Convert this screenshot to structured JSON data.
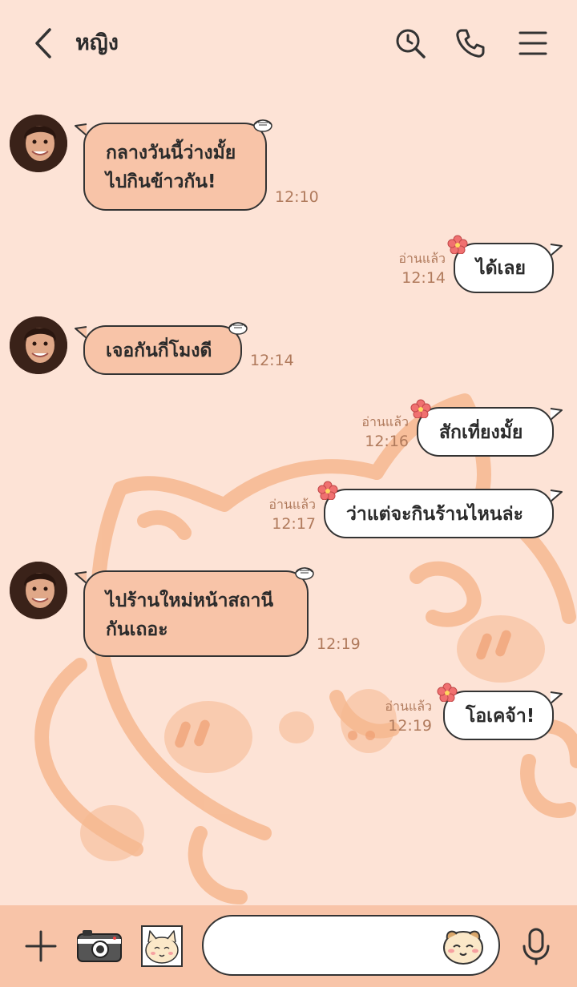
{
  "header": {
    "title": "หญิง",
    "icons": [
      "back-icon",
      "search-history-icon",
      "phone-icon",
      "menu-icon"
    ]
  },
  "messages": [
    {
      "side": "in",
      "lines": [
        "กลางวันนี้ว่างมั้ย",
        "ไปกินข้าวกัน!"
      ],
      "time": "12:10"
    },
    {
      "side": "out",
      "text": "ได้เลย",
      "status": "อ่านแล้ว",
      "time": "12:14"
    },
    {
      "side": "in",
      "text": "เจอกันกี่โมงดี",
      "time": "12:14"
    },
    {
      "side": "out",
      "text": "สักเที่ยงมั้ย",
      "status": "อ่านแล้ว",
      "time": "12:16"
    },
    {
      "side": "out",
      "text": "ว่าแต่จะกินร้านไหนล่ะ",
      "status": "อ่านแล้ว",
      "time": "12:17"
    },
    {
      "side": "in",
      "lines": [
        "ไปร้านใหม่หน้าสถานี",
        "กันเถอะ"
      ],
      "time": "12:19"
    },
    {
      "side": "out",
      "text": "โอเคจ้า!",
      "status": "อ่านแล้ว",
      "time": "12:19"
    }
  ],
  "input": {
    "placeholder": ""
  },
  "colors": {
    "background": "#fde3d6",
    "incoming_bubble": "#f8c4a8",
    "outgoing_bubble": "#ffffff",
    "meta_text": "#b07a5c",
    "bottom_bar": "#f8c4a8"
  }
}
